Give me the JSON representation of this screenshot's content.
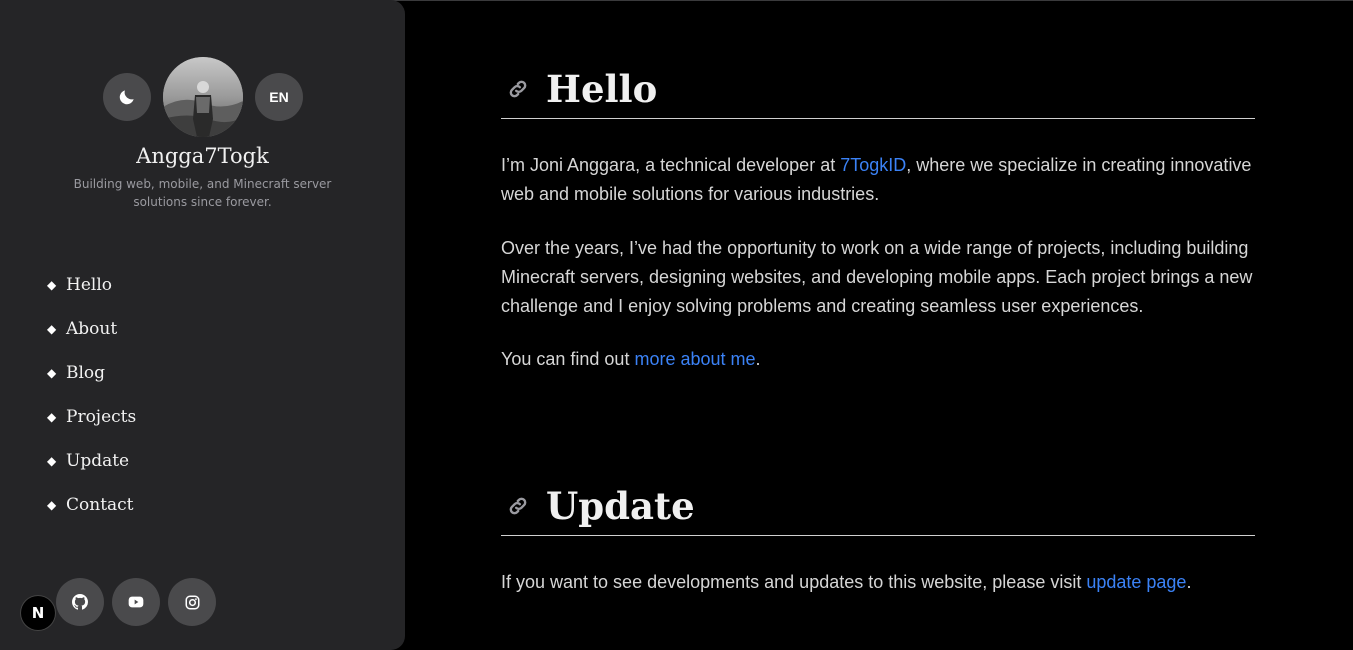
{
  "sidebar": {
    "language_label": "EN",
    "site_name": "Angga7Togk",
    "tagline": "Building web, mobile, and Minecraft server solutions since forever.",
    "nav_items": [
      {
        "label": "Hello"
      },
      {
        "label": "About"
      },
      {
        "label": "Blog"
      },
      {
        "label": "Projects"
      },
      {
        "label": "Update"
      },
      {
        "label": "Contact"
      }
    ],
    "social_icons": [
      "github-icon",
      "youtube-icon",
      "instagram-icon"
    ],
    "framework_badge": "N"
  },
  "main": {
    "hello": {
      "title": "Hello",
      "p1_prefix": "I’m Joni Anggara, a technical developer at ",
      "p1_link": "7TogkID",
      "p1_suffix": ", where we specialize in creating innovative web and mobile solutions for various industries.",
      "p2": "Over the years, I’ve had the opportunity to work on a wide range of projects, including building Minecraft servers, designing websites, and developing mobile apps. Each project brings a new challenge and I enjoy solving problems and creating seamless user experiences.",
      "p3_prefix": "You can find out ",
      "p3_link": "more about me",
      "p3_suffix": "."
    },
    "update": {
      "title": "Update",
      "p1_prefix": "If you want to see developments and updates to this website, please visit ",
      "p1_link": "update page",
      "p1_suffix": "."
    }
  },
  "colors": {
    "background": "#000000",
    "sidebar": "#252527",
    "link": "#3b82f6",
    "text": "#d6d6d6"
  }
}
